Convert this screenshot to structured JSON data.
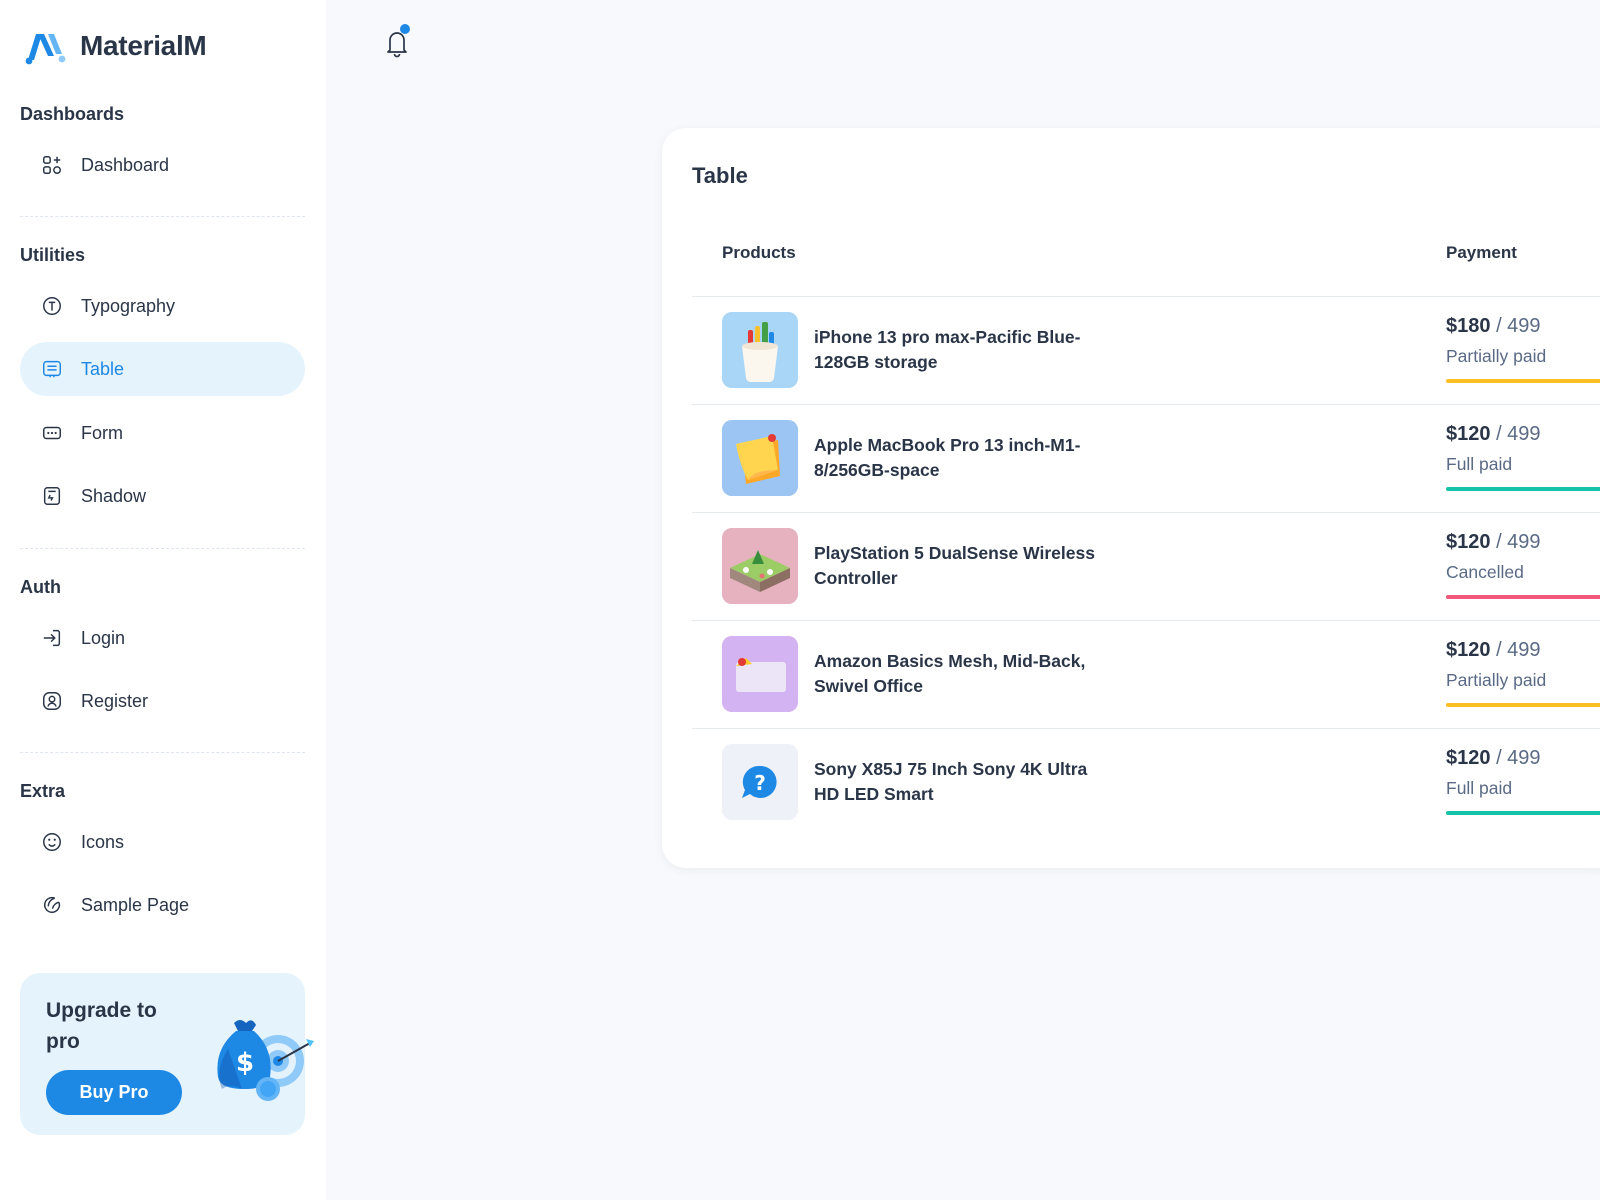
{
  "brand": {
    "name": "MaterialM"
  },
  "sidebar": {
    "sections": [
      {
        "title": "Dashboards",
        "items": [
          {
            "label": "Dashboard",
            "icon": "grid-icon"
          }
        ]
      },
      {
        "title": "Utilities",
        "items": [
          {
            "label": "Typography",
            "icon": "typography-icon"
          },
          {
            "label": "Table",
            "icon": "table-icon",
            "active": true
          },
          {
            "label": "Form",
            "icon": "form-icon"
          },
          {
            "label": "Shadow",
            "icon": "shadow-icon"
          }
        ]
      },
      {
        "title": "Auth",
        "items": [
          {
            "label": "Login",
            "icon": "login-icon"
          },
          {
            "label": "Register",
            "icon": "register-icon"
          }
        ]
      },
      {
        "title": "Extra",
        "items": [
          {
            "label": "Icons",
            "icon": "smile-icon"
          },
          {
            "label": "Sample Page",
            "icon": "sample-page-icon"
          }
        ]
      }
    ],
    "upgrade": {
      "title": "Upgrade to pro",
      "button": "Buy Pro"
    }
  },
  "header": {
    "notification_icon": "bell-icon",
    "has_unread": true
  },
  "table_card": {
    "title": "Table",
    "columns": [
      "Products",
      "Payment"
    ],
    "rows": [
      {
        "product": "iPhone 13 pro max-Pacific Blue-128GB storage",
        "thumb": "pencil-cup",
        "paid": "$180",
        "total": "/ 499",
        "status": "Partially paid",
        "progress": 0.36,
        "status_color": "#fbbf24"
      },
      {
        "product": "Apple MacBook Pro 13 inch-M1-8/256GB-space",
        "thumb": "sticky-notes",
        "paid": "$120",
        "total": "/ 499",
        "status": "Full paid",
        "progress": 1.0,
        "status_color": "#14c3a8"
      },
      {
        "product": "PlayStation 5 DualSense Wireless Controller",
        "thumb": "garden-block",
        "paid": "$120",
        "total": "/ 499",
        "status": "Cancelled",
        "progress": 0.24,
        "status_color": "#f0577a"
      },
      {
        "product": "Amazon Basics Mesh, Mid-Back, Swivel Office",
        "thumb": "note-card",
        "paid": "$120",
        "total": "/ 499",
        "status": "Partially paid",
        "progress": 0.24,
        "status_color": "#fbbf24"
      },
      {
        "product": "Sony X85J 75 Inch Sony 4K Ultra HD LED Smart",
        "thumb": "question-bubble",
        "paid": "$120",
        "total": "/ 499",
        "status": "Full paid",
        "progress": 1.0,
        "status_color": "#14c3a8"
      }
    ]
  },
  "colors": {
    "primary": "#1e88e5",
    "active_bg": "#e5f3fd",
    "warning": "#fbbf24",
    "success": "#14c3a8",
    "error": "#f0577a"
  }
}
